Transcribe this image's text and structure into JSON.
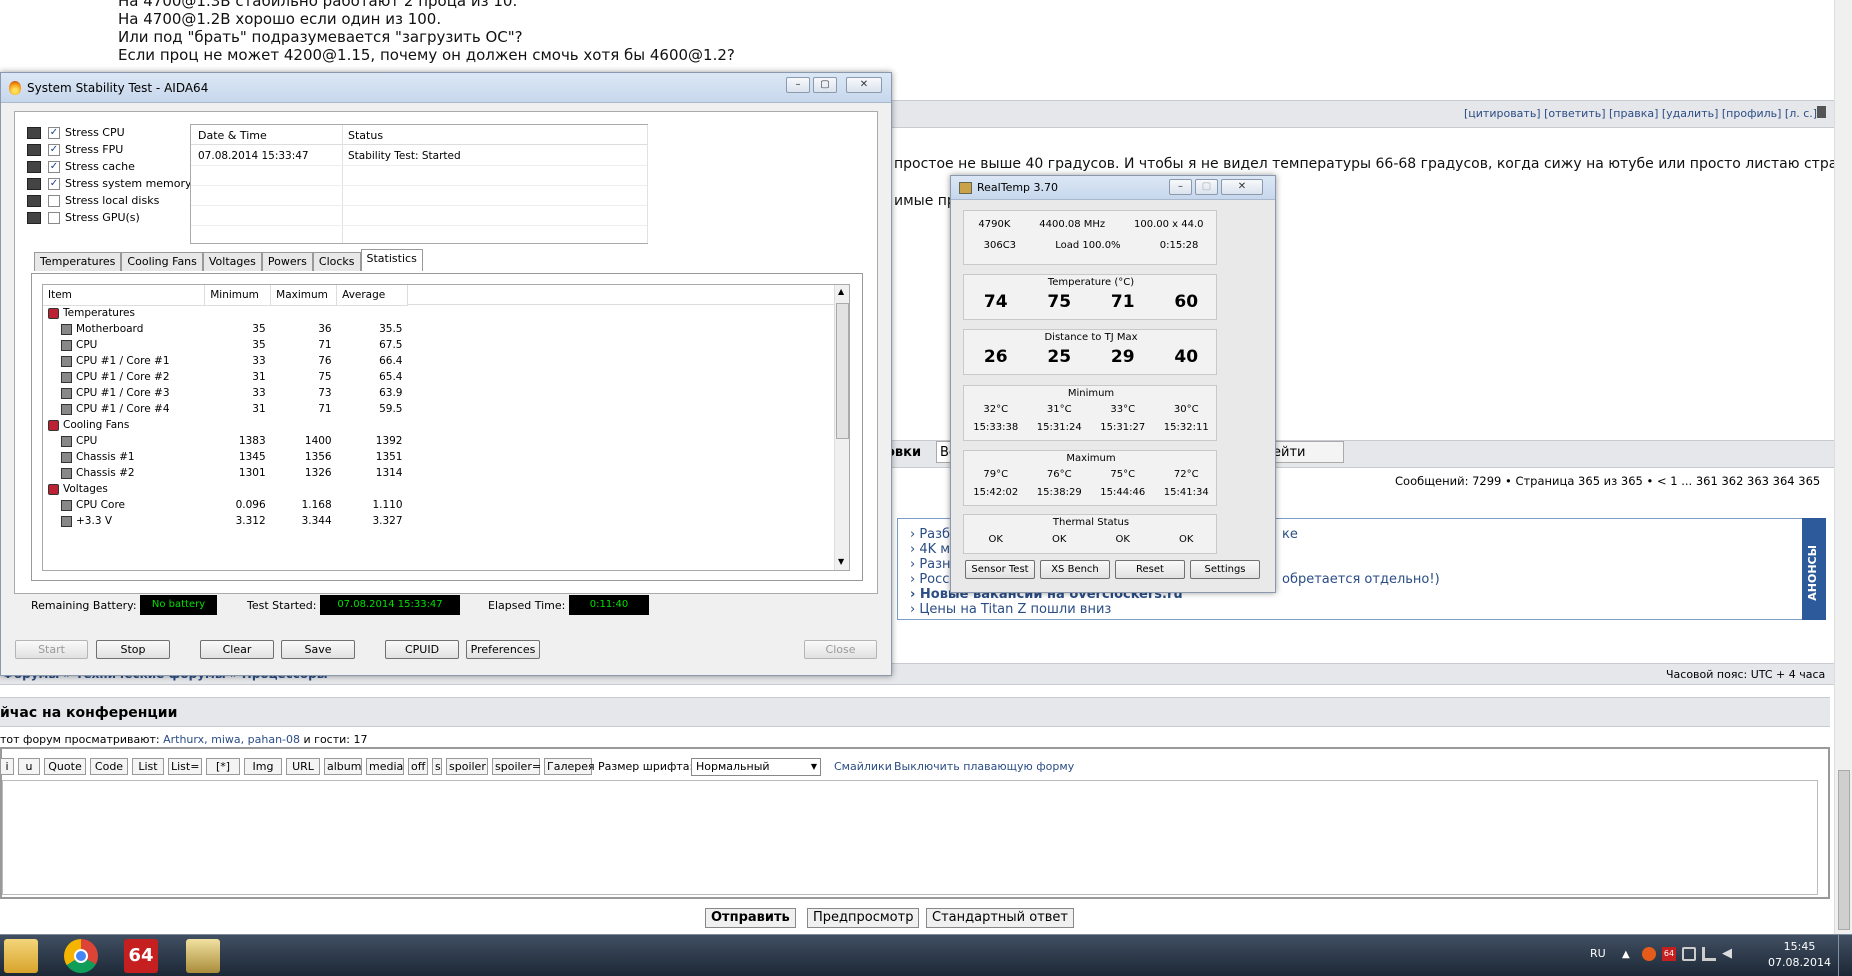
{
  "forum": {
    "post_lines": [
      "На 4700@1.3В стабильно работают 2 проца из 10.",
      "На 4700@1.2В хорошо если один из 100.",
      "Или под \"брать\" подразумевается \"загрузить ОС\"?",
      "Если проц не может 4200@1.15, почему он должен смочь хотя бы 4600@1.2?"
    ],
    "actions": "[цитировать] [ответить] [правка] [удалить] [профиль] [л. с.]",
    "post_text": "простое не выше 40 градусов. И чтобы я не видел температуры 66-68 градусов, когда сижу на ютубе или просто листаю странички",
    "post_text2": "имые про",
    "tab_fragment_left": "овки",
    "tab_fragment_left2": "Вс",
    "tab_fragment_right": "ейти",
    "pagination": "Сообщений: 7299 • Страница 365 из 365 • < 1 ... 361 362 363 364 365",
    "news": [
      "› Разбл",
      "› 4K мо",
      "› Разны",
      "› Росси",
      "› Новые вакансии на overclockers.ru",
      "› Цены на Titan Z пошли вниз"
    ],
    "news_right": "ке",
    "news_right2": "обретается отдельно!)",
    "announce": "АНОНСЫ",
    "breadcrumb": "Форумы » Технические форумы » Процессоры",
    "timezone": "Часовой пояс: UTC + 4 часа",
    "conference_title": "йчас на конференции",
    "viewers_prefix": "тот форум просматривают:",
    "viewers": "Arthurx, miwa, pahan-08",
    "viewers_suffix": "и гости: 17",
    "editor_buttons": [
      "i",
      "u",
      "Quote",
      "Code",
      "List",
      "List=",
      "[*]",
      "Img",
      "URL",
      "album",
      "media",
      "off",
      "s",
      "spoiler",
      "spoiler=",
      "Галерея"
    ],
    "font_size_label": "Размер шрифта:",
    "font_size_value": "Нормальный",
    "smilies": "Смайлики",
    "floating": "Выключить плавающую форму",
    "submit": "Отправить",
    "preview": "Предпросмотр",
    "standard": "Стандартный ответ"
  },
  "aida": {
    "title": "System Stability Test - AIDA64",
    "stress": [
      {
        "label": "Stress CPU",
        "checked": true
      },
      {
        "label": "Stress FPU",
        "checked": true
      },
      {
        "label": "Stress cache",
        "checked": true
      },
      {
        "label": "Stress system memory",
        "checked": true
      },
      {
        "label": "Stress local disks",
        "checked": false
      },
      {
        "label": "Stress GPU(s)",
        "checked": false
      }
    ],
    "log_headers": [
      "Date & Time",
      "Status"
    ],
    "log_rows": [
      [
        "07.08.2014 15:33:47",
        "Stability Test: Started"
      ]
    ],
    "tabs": [
      "Temperatures",
      "Cooling Fans",
      "Voltages",
      "Powers",
      "Clocks",
      "Statistics"
    ],
    "active_tab": "Statistics",
    "stat_headers": [
      "Item",
      "Minimum",
      "Maximum",
      "Average"
    ],
    "stat_rows": [
      {
        "item": "Temperatures",
        "group": true,
        "min": "",
        "max": "",
        "avg": ""
      },
      {
        "item": "Motherboard",
        "min": "35",
        "max": "36",
        "avg": "35.5"
      },
      {
        "item": "CPU",
        "min": "35",
        "max": "71",
        "avg": "67.5"
      },
      {
        "item": "CPU #1 / Core #1",
        "min": "33",
        "max": "76",
        "avg": "66.4"
      },
      {
        "item": "CPU #1 / Core #2",
        "min": "31",
        "max": "75",
        "avg": "65.4"
      },
      {
        "item": "CPU #1 / Core #3",
        "min": "33",
        "max": "73",
        "avg": "63.9"
      },
      {
        "item": "CPU #1 / Core #4",
        "min": "31",
        "max": "71",
        "avg": "59.5"
      },
      {
        "item": "Cooling Fans",
        "group": true,
        "min": "",
        "max": "",
        "avg": ""
      },
      {
        "item": "CPU",
        "min": "1383",
        "max": "1400",
        "avg": "1392"
      },
      {
        "item": "Chassis #1",
        "min": "1345",
        "max": "1356",
        "avg": "1351"
      },
      {
        "item": "Chassis #2",
        "min": "1301",
        "max": "1326",
        "avg": "1314"
      },
      {
        "item": "Voltages",
        "group": true,
        "min": "",
        "max": "",
        "avg": ""
      },
      {
        "item": "CPU Core",
        "min": "0.096",
        "max": "1.168",
        "avg": "1.110"
      },
      {
        "item": "+3.3 V",
        "min": "3.312",
        "max": "3.344",
        "avg": "3.327"
      }
    ],
    "remaining_battery_label": "Remaining Battery:",
    "remaining_battery": "No battery",
    "test_started_label": "Test Started:",
    "test_started": "07.08.2014 15:33:47",
    "elapsed_label": "Elapsed Time:",
    "elapsed": "0:11:40",
    "buttons": {
      "start": "Start",
      "stop": "Stop",
      "clear": "Clear",
      "save": "Save",
      "cpuid": "CPUID",
      "preferences": "Preferences",
      "close": "Close"
    }
  },
  "realtemp": {
    "title": "RealTemp 3.70",
    "cpu": "4790K",
    "freq": "4400.08 MHz",
    "mult": "100.00 x 44.0",
    "stepping": "306C3",
    "load": "Load 100.0%",
    "uptime": "0:15:28",
    "temp_label": "Temperature (°C)",
    "temps": [
      "74",
      "75",
      "71",
      "60"
    ],
    "tj_label": "Distance to TJ Max",
    "tj": [
      "26",
      "25",
      "29",
      "40"
    ],
    "min_label": "Minimum",
    "min_t": [
      "32°C",
      "31°C",
      "33°C",
      "30°C"
    ],
    "min_time": [
      "15:33:38",
      "15:31:24",
      "15:31:27",
      "15:32:11"
    ],
    "max_label": "Maximum",
    "max_t": [
      "79°C",
      "76°C",
      "75°C",
      "72°C"
    ],
    "max_time": [
      "15:42:02",
      "15:38:29",
      "15:44:46",
      "15:41:34"
    ],
    "thermal_label": "Thermal Status",
    "thermal": [
      "OK",
      "OK",
      "OK",
      "OK"
    ],
    "buttons": [
      "Sensor Test",
      "XS Bench",
      "Reset",
      "Settings"
    ]
  },
  "taskbar": {
    "lang": "RU",
    "time": "15:45",
    "date": "07.08.2014"
  }
}
